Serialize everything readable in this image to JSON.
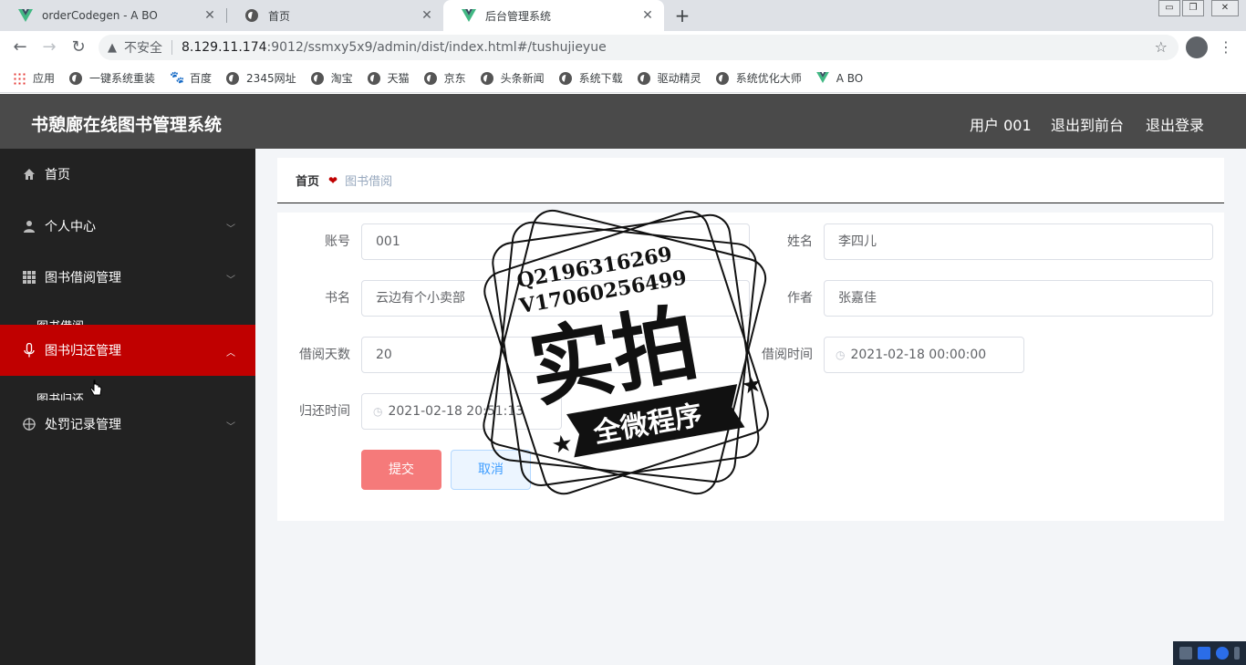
{
  "browser": {
    "tabs": [
      {
        "title": "orderCodegen - A BO"
      },
      {
        "title": "首页"
      },
      {
        "title": "后台管理系统"
      }
    ],
    "address": {
      "security": "不安全",
      "host": "8.129.11.174",
      "path": ":9012/ssmxy5x9/admin/dist/index.html#/tushujieyue"
    },
    "bookmarks": [
      "应用",
      "一键系统重装",
      "百度",
      "2345网址",
      "淘宝",
      "天猫",
      "京东",
      "头条新闻",
      "系统下载",
      "驱动精灵",
      "系统优化大师",
      "A BO"
    ]
  },
  "header": {
    "title": "书憩廊在线图书管理系统",
    "user": "用户 001",
    "to_front": "退出到前台",
    "logout": "退出登录"
  },
  "sidebar": {
    "items": [
      {
        "label": "首页",
        "icon": "home-icon"
      },
      {
        "label": "个人中心",
        "icon": "user-icon"
      },
      {
        "label": "图书借阅管理",
        "icon": "grid-icon"
      },
      {
        "label": "图书归还管理",
        "icon": "microphone-icon"
      },
      {
        "label": "处罚记录管理",
        "icon": "target-icon"
      }
    ],
    "subitems": [
      "图书借阅",
      "图书归还"
    ]
  },
  "breadcrumb": {
    "home": "首页",
    "current": "图书借阅"
  },
  "form": {
    "account_label": "账号",
    "account_value": "001",
    "name_label": "姓名",
    "name_value": "李四儿",
    "book_label": "书名",
    "book_value": "云边有个小卖部",
    "author_label": "作者",
    "author_value": "张嘉佳",
    "days_label": "借阅天数",
    "days_value": "20",
    "borrow_time_label": "借阅时间",
    "borrow_time_value": "2021-02-18 00:00:00",
    "return_time_label": "归还时间",
    "return_time_value": "2021-02-18 20:51:13",
    "submit": "提交",
    "cancel": "取消"
  },
  "stamp": {
    "line1": "Q2196316269",
    "line2": "V17060256499",
    "big": "实拍",
    "banner": "全微程序"
  },
  "colors": {
    "header_bg": "#4a4a4a",
    "sidebar_bg": "#222222",
    "active_red": "#c00000",
    "submit_bg": "#f56c6c",
    "cancel_bg": "#ecf5ff"
  }
}
